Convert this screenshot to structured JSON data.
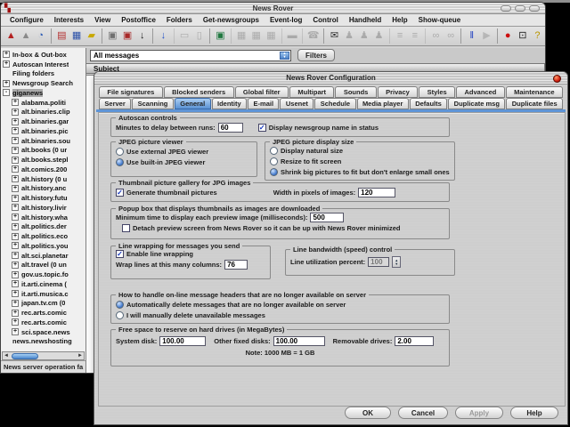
{
  "window": {
    "title": "News Rover",
    "menu": [
      "Configure",
      "Interests",
      "View",
      "Postoffice",
      "Folders",
      "Get-newsgroups",
      "Event-log",
      "Control",
      "Handheld",
      "Help",
      "Show-queue"
    ],
    "toolbar": [
      {
        "name": "scan-start-icon",
        "glyph": "▲",
        "color": "#b42222",
        "enabled": true,
        "sep": false
      },
      {
        "name": "scan-alt-icon",
        "glyph": "▲",
        "color": "#8a8a8a",
        "enabled": true,
        "sep": false
      },
      {
        "name": "schedule-clock-icon",
        "glyph": "◔",
        "color": "#2a5ab4",
        "enabled": true,
        "sep": false
      },
      {
        "name": "server-icon",
        "glyph": "▤",
        "color": "#b43030",
        "enabled": true,
        "sep": true
      },
      {
        "name": "newsgroups-icon",
        "glyph": "▦",
        "color": "#2a50a8",
        "enabled": true,
        "sep": false
      },
      {
        "name": "folders-icon",
        "glyph": "▰",
        "color": "#c8a800",
        "enabled": true,
        "sep": false
      },
      {
        "name": "post-message-icon",
        "glyph": "▣",
        "color": "#707070",
        "enabled": true,
        "sep": true
      },
      {
        "name": "post-cancel-icon",
        "glyph": "▣",
        "color": "#a82828",
        "enabled": true,
        "sep": false
      },
      {
        "name": "download-icon",
        "glyph": "↓",
        "color": "#1a1a1a",
        "enabled": true,
        "sep": false
      },
      {
        "name": "download-all-icon",
        "glyph": "↓",
        "color": "#2050c8",
        "enabled": true,
        "sep": true
      },
      {
        "name": "print-icon",
        "glyph": "▭",
        "color": "#606060",
        "enabled": false,
        "sep": true
      },
      {
        "name": "save-icon",
        "glyph": "▯",
        "color": "#606060",
        "enabled": false,
        "sep": false
      },
      {
        "name": "view-image-icon",
        "glyph": "▣",
        "color": "#207840",
        "enabled": true,
        "sep": true
      },
      {
        "name": "gallery-icon",
        "glyph": "▦",
        "color": "#606060",
        "enabled": false,
        "sep": true
      },
      {
        "name": "slideshow-icon",
        "glyph": "▦",
        "color": "#606060",
        "enabled": false,
        "sep": false
      },
      {
        "name": "thumbnail-icon",
        "glyph": "▦",
        "color": "#606060",
        "enabled": false,
        "sep": false
      },
      {
        "name": "archive-icon",
        "glyph": "▬",
        "color": "#606060",
        "enabled": false,
        "sep": true
      },
      {
        "name": "handheld-icon",
        "glyph": "☎",
        "color": "#606060",
        "enabled": false,
        "sep": true
      },
      {
        "name": "mail-icon",
        "glyph": "✉",
        "color": "#303030",
        "enabled": true,
        "sep": true
      },
      {
        "name": "user-add-icon",
        "glyph": "♟",
        "color": "#606060",
        "enabled": false,
        "sep": false
      },
      {
        "name": "user-remove-icon",
        "glyph": "♟",
        "color": "#606060",
        "enabled": false,
        "sep": false
      },
      {
        "name": "users-icon",
        "glyph": "♟",
        "color": "#606060",
        "enabled": false,
        "sep": false
      },
      {
        "name": "list-view-icon",
        "glyph": "≡",
        "color": "#606060",
        "enabled": false,
        "sep": true
      },
      {
        "name": "list-alt-icon",
        "glyph": "≡",
        "color": "#606060",
        "enabled": false,
        "sep": false
      },
      {
        "name": "search-icon",
        "glyph": "∞",
        "color": "#606060",
        "enabled": false,
        "sep": true
      },
      {
        "name": "search-next-icon",
        "glyph": "∞",
        "color": "#606060",
        "enabled": false,
        "sep": false
      },
      {
        "name": "pause-icon",
        "glyph": "‖",
        "color": "#2040c0",
        "enabled": true,
        "sep": true
      },
      {
        "name": "resume-icon",
        "glyph": "▶",
        "color": "#808080",
        "enabled": false,
        "sep": false
      },
      {
        "name": "stop-icon",
        "glyph": "●",
        "color": "#cc1010",
        "enabled": true,
        "sep": true
      },
      {
        "name": "exit-icon",
        "glyph": "⊡",
        "color": "#1a1a1a",
        "enabled": true,
        "sep": false
      },
      {
        "name": "help-icon",
        "glyph": "?",
        "color": "#b89400",
        "enabled": true,
        "sep": false
      }
    ],
    "filter_dropdown_value": "All messages",
    "filters_button": "Filters",
    "column_header": "Subject",
    "tree": [
      {
        "label": "In-box & Out-box",
        "box": "+",
        "level": 0,
        "selected": false
      },
      {
        "label": "Autoscan Interest",
        "box": "+",
        "level": 0,
        "selected": false
      },
      {
        "label": "Filing folders",
        "box": "",
        "level": 0,
        "selected": false
      },
      {
        "label": "Newsgroup Search",
        "box": "+",
        "level": 0,
        "selected": false
      },
      {
        "label": "giganews",
        "box": "-",
        "level": 0,
        "selected": true
      },
      {
        "label": "alabama.politi",
        "box": "+",
        "level": 1,
        "selected": false
      },
      {
        "label": "alt.binaries.clip",
        "box": "+",
        "level": 1,
        "selected": false
      },
      {
        "label": "alt.binaries.gar",
        "box": "+",
        "level": 1,
        "selected": false
      },
      {
        "label": "alt.binaries.pic",
        "box": "+",
        "level": 1,
        "selected": false
      },
      {
        "label": "alt.binaries.sou",
        "box": "+",
        "level": 1,
        "selected": false
      },
      {
        "label": "alt.books (0 ur",
        "box": "+",
        "level": 1,
        "selected": false
      },
      {
        "label": "alt.books.stepl",
        "box": "+",
        "level": 1,
        "selected": false
      },
      {
        "label": "alt.comics.200",
        "box": "+",
        "level": 1,
        "selected": false
      },
      {
        "label": "alt.history (0 u",
        "box": "+",
        "level": 1,
        "selected": false
      },
      {
        "label": "alt.history.anc",
        "box": "+",
        "level": 1,
        "selected": false
      },
      {
        "label": "alt.history.futu",
        "box": "+",
        "level": 1,
        "selected": false
      },
      {
        "label": "alt.history.livir",
        "box": "+",
        "level": 1,
        "selected": false
      },
      {
        "label": "alt.history.wha",
        "box": "+",
        "level": 1,
        "selected": false
      },
      {
        "label": "alt.politics.der",
        "box": "+",
        "level": 1,
        "selected": false
      },
      {
        "label": "alt.politics.eco",
        "box": "+",
        "level": 1,
        "selected": false
      },
      {
        "label": "alt.politics.you",
        "box": "+",
        "level": 1,
        "selected": false
      },
      {
        "label": "alt.sci.planetar",
        "box": "+",
        "level": 1,
        "selected": false
      },
      {
        "label": "alt.travel (0 un",
        "box": "+",
        "level": 1,
        "selected": false
      },
      {
        "label": "gov.us.topic.fo",
        "box": "+",
        "level": 1,
        "selected": false
      },
      {
        "label": "it.arti.cinema (",
        "box": "+",
        "level": 1,
        "selected": false
      },
      {
        "label": "it.arti.musica.c",
        "box": "+",
        "level": 1,
        "selected": false
      },
      {
        "label": "japan.tv.cm (0",
        "box": "+",
        "level": 1,
        "selected": false
      },
      {
        "label": "rec.arts.comic",
        "box": "+",
        "level": 1,
        "selected": false
      },
      {
        "label": "rec.arts.comic",
        "box": "+",
        "level": 1,
        "selected": false
      },
      {
        "label": "sci.space.news",
        "box": "+",
        "level": 1,
        "selected": false
      },
      {
        "label": "news.newshosting",
        "box": "",
        "level": 0,
        "selected": false
      }
    ],
    "status_text": "News server operation fa"
  },
  "dialog": {
    "title": "News Rover Configuration",
    "tabs_row1": [
      {
        "label": "File signatures",
        "active": false
      },
      {
        "label": "Blocked senders",
        "active": false
      },
      {
        "label": "Global filter",
        "active": false
      },
      {
        "label": "Multipart",
        "active": false
      },
      {
        "label": "Sounds",
        "active": false
      },
      {
        "label": "Privacy",
        "active": false
      },
      {
        "label": "Styles",
        "active": false
      },
      {
        "label": "Advanced",
        "active": false
      },
      {
        "label": "Maintenance",
        "active": false
      }
    ],
    "tabs_row2": [
      {
        "label": "Server",
        "active": false
      },
      {
        "label": "Scanning",
        "active": false
      },
      {
        "label": "General",
        "active": true
      },
      {
        "label": "Identity",
        "active": false
      },
      {
        "label": "E-mail",
        "active": false
      },
      {
        "label": "Usenet",
        "active": false
      },
      {
        "label": "Schedule",
        "active": false
      },
      {
        "label": "Media player",
        "active": false
      },
      {
        "label": "Defaults",
        "active": false
      },
      {
        "label": "Duplicate msg",
        "active": false
      },
      {
        "label": "Duplicate files",
        "active": false
      }
    ],
    "form": {
      "autoscan": {
        "legend": "Autoscan controls",
        "minutes_label": "Minutes to delay between runs:",
        "minutes_value": "60",
        "display_name_label": "Display newsgroup name in status",
        "display_name_on": true
      },
      "jpeg_viewer": {
        "legend": "JPEG picture viewer",
        "options": [
          {
            "label": "Use external JPEG viewer",
            "on": false
          },
          {
            "label": "Use built-in JPEG viewer",
            "on": true
          }
        ]
      },
      "jpeg_size": {
        "legend": "JPEG picture display size",
        "options": [
          {
            "label": "Display natural size",
            "on": false
          },
          {
            "label": "Resize to fit screen",
            "on": false
          },
          {
            "label": "Shrink big pictures to fit but don't enlarge small ones",
            "on": true
          }
        ]
      },
      "thumbnail": {
        "legend": "Thumbnail picture gallery for JPG images",
        "generate_label": "Generate thumbnail pictures",
        "generate_on": true,
        "width_label": "Width in pixels of images:",
        "width_value": "120"
      },
      "popup": {
        "legend": "Popup box that displays thumbnails as images are downloaded",
        "min_time_label": "Minimum time to display each preview image (milliseconds):",
        "min_time_value": "500",
        "detach_label": "Detach preview screen from News Rover so it can be up with News Rover minimized",
        "detach_on": false
      },
      "wrap": {
        "legend": "Line wrapping for messages you send",
        "enable_label": "Enable line wrapping",
        "enable_on": true,
        "columns_label": "Wrap lines at this many columns:",
        "columns_value": "76"
      },
      "bandwidth": {
        "legend": "Line bandwidth (speed) control",
        "utilization_label": "Line utilization percent:",
        "utilization_value": "100"
      },
      "headers": {
        "legend": "How to handle on-line message headers that are no longer available on server",
        "options": [
          {
            "label": "Automatically delete messages that are no longer available on server",
            "on": true
          },
          {
            "label": "I will manually delete unavailable messages",
            "on": false
          }
        ]
      },
      "freespace": {
        "legend": "Free space to reserve on hard drives (in MegaBytes)",
        "system_label": "System disk:",
        "system_value": "100.00",
        "other_label": "Other fixed disks:",
        "other_value": "100.00",
        "removable_label": "Removable drives:",
        "removable_value": "2.00",
        "note": "Note: 1000 MB = 1 GB"
      }
    },
    "buttons": {
      "ok": "OK",
      "cancel": "Cancel",
      "apply": "Apply",
      "help": "Help"
    }
  }
}
